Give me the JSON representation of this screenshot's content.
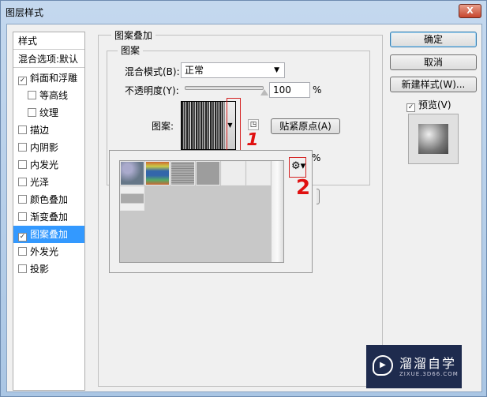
{
  "window": {
    "title": "图层样式",
    "close": "X"
  },
  "styles_list": {
    "header": "样式",
    "blend_options": "混合选项:默认",
    "items": [
      {
        "label": "斜面和浮雕",
        "checked": true
      },
      {
        "label": "等高线",
        "checked": false
      },
      {
        "label": "纹理",
        "checked": false
      },
      {
        "label": "描边",
        "checked": false
      },
      {
        "label": "内阴影",
        "checked": false
      },
      {
        "label": "内发光",
        "checked": false
      },
      {
        "label": "光泽",
        "checked": false
      },
      {
        "label": "颜色叠加",
        "checked": false
      },
      {
        "label": "渐变叠加",
        "checked": false
      },
      {
        "label": "图案叠加",
        "checked": true
      },
      {
        "label": "外发光",
        "checked": false
      },
      {
        "label": "投影",
        "checked": false
      }
    ]
  },
  "panel": {
    "group_title": "图案叠加",
    "sub_title": "图案",
    "blend_mode_label": "混合模式(B):",
    "blend_mode_value": "正常",
    "opacity_label": "不透明度(Y):",
    "opacity_value": "100",
    "opacity_unit": "%",
    "opacity_fraction": 1.0,
    "pattern_label": "图案:",
    "snap_button": "贴紧原点(A)",
    "scale_unit": "%"
  },
  "buttons": {
    "ok": "确定",
    "cancel": "取消",
    "new_style": "新建样式(W)...",
    "preview_label": "预览(V)",
    "preview_checked": true
  },
  "annotations": {
    "one": "1",
    "two": "2"
  },
  "watermark": {
    "name": "溜溜自学",
    "url": "ZIXUE.3D66.COM"
  }
}
